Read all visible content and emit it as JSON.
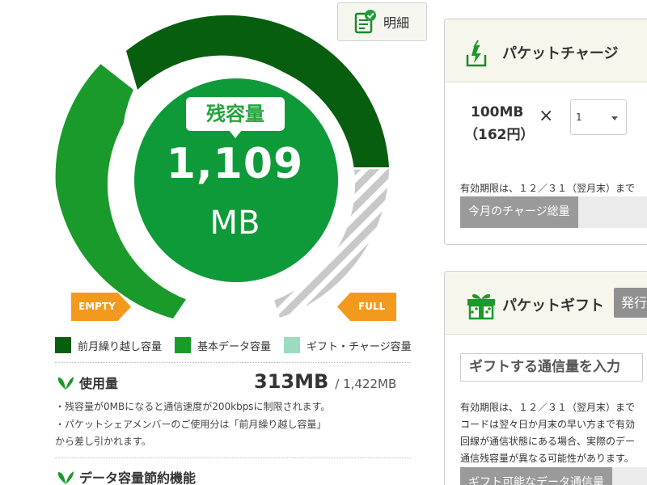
{
  "detail_button": {
    "label": "明細"
  },
  "gauge": {
    "remaining_label": "残容量",
    "remaining_value": "1,109",
    "remaining_unit": "MB",
    "empty_label": "EMPTY",
    "full_label": "FULL"
  },
  "legend": [
    {
      "label": "前月繰り越し容量",
      "color": "#075e0f"
    },
    {
      "label": "基本データ容量",
      "color": "#1a9a2a"
    },
    {
      "label": "ギフト・チャージ容量",
      "color": "#9adcc0"
    }
  ],
  "usage": {
    "title": "使用量",
    "used": "313MB",
    "total": "/ 1,422MB",
    "notes": [
      "・残容量が0MBになると通信速度が200kbpsに制限されます。",
      "・パケットシェアメンバーのご使用分は「前月繰り越し容量」",
      "から差し引かれます。"
    ]
  },
  "saving": {
    "title": "データ容量節約機能"
  },
  "charge": {
    "title": "パケットチャージ",
    "size_line1": "100MB",
    "size_line2": "（162円）",
    "times": "×",
    "qty": "1",
    "expiry": "有効期限は、１２／３１（翌月末）まで",
    "total_label": "今月のチャージ総量"
  },
  "gift": {
    "title": "パケットギフト",
    "issue_label": "発行",
    "input_placeholder": "ギフトする通信量を入力",
    "lines": [
      "有効期限は、１２／３１（翌月末）まで",
      "コードは翌々日か月末の早い方まで有効",
      "回線が通信状態にある場合、実際のデー",
      "通信残容量が異なる可能性があります。"
    ],
    "available_label": "ギフト可能なデータ通信量"
  },
  "colors": {
    "dark_green": "#075e0f",
    "green": "#1a9a2a",
    "center_green": "#0f9a3a",
    "gift_gray": "#c8c8c8",
    "orange": "#f39a1e"
  }
}
